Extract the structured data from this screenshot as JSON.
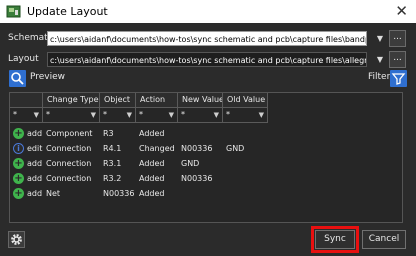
{
  "window": {
    "title": "Update Layout",
    "close_glyph": "✕"
  },
  "schematic": {
    "label": "Schematic",
    "path": "c:\\users\\aidanf\\documents\\how-tos\\sync schematic and pcb\\capture files\\bandpass.opj",
    "browse_label": "..."
  },
  "layout": {
    "label": "Layout",
    "path": "c:\\users\\aidanf\\documents\\how-tos\\sync schematic and pcb\\capture files\\allegro\\bandpass.brd",
    "browse_label": "..."
  },
  "toolbar": {
    "preview_label": "Preview",
    "filter_label": "Filter"
  },
  "table": {
    "columns": [
      "",
      "Change Type",
      "Object",
      "Action",
      "New Value",
      "Old Value"
    ],
    "filter_placeholder": "*",
    "rows": [
      {
        "status": "add",
        "type": "Component",
        "object": "R3",
        "action": "Added",
        "new": "",
        "old": ""
      },
      {
        "status": "edit",
        "type": "Connection",
        "object": "R4.1",
        "action": "Changed",
        "new": "N00336",
        "old": "GND"
      },
      {
        "status": "add",
        "type": "Connection",
        "object": "R3.1",
        "action": "Added",
        "new": "GND",
        "old": ""
      },
      {
        "status": "add",
        "type": "Connection",
        "object": "R3.2",
        "action": "Added",
        "new": "N00336",
        "old": ""
      },
      {
        "status": "add",
        "type": "Net",
        "object": "N00336",
        "action": "Added",
        "new": "",
        "old": ""
      }
    ]
  },
  "footer": {
    "sync_label": "Sync",
    "cancel_label": "Cancel"
  },
  "colors": {
    "accent_blue": "#2f6fd0",
    "add_green": "#3fb44c",
    "highlight_red": "#e81010"
  }
}
